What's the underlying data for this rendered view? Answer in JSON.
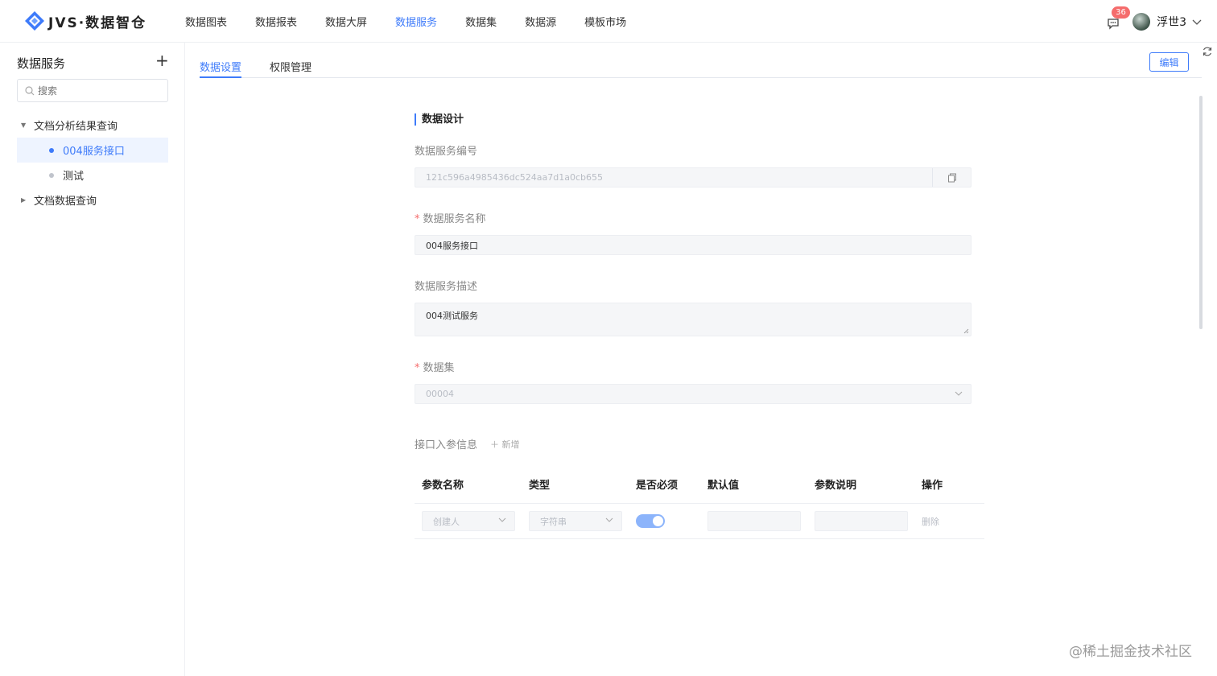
{
  "app": {
    "brand": "JVS·数据智仓",
    "accent": "#3e7bfa"
  },
  "nav": {
    "items": [
      {
        "label": "数据图表",
        "active": false
      },
      {
        "label": "数据报表",
        "active": false
      },
      {
        "label": "数据大屏",
        "active": false
      },
      {
        "label": "数据服务",
        "active": true
      },
      {
        "label": "数据集",
        "active": false
      },
      {
        "label": "数据源",
        "active": false
      },
      {
        "label": "模板市场",
        "active": false
      }
    ]
  },
  "header": {
    "message_icon": "message-icon",
    "badge_count": "36",
    "username": "浮世3",
    "dropdown_icon": "chevron-down-icon"
  },
  "sidebar": {
    "title": "数据服务",
    "add_icon": "plus-icon",
    "search_placeholder": "搜索",
    "tree": [
      {
        "label": "文档分析结果查询",
        "expanded": true,
        "children": [
          {
            "label": "004服务接口",
            "selected": true
          },
          {
            "label": "测试",
            "selected": false
          }
        ]
      },
      {
        "label": "文档数据查询",
        "expanded": false,
        "children": []
      }
    ]
  },
  "main": {
    "tabs": [
      {
        "label": "数据设置",
        "active": true
      },
      {
        "label": "权限管理",
        "active": false
      }
    ],
    "edit_label": "编辑",
    "refresh_icon": "refresh-icon"
  },
  "form": {
    "section_title": "数据设计",
    "service_id_label": "数据服务编号",
    "service_id_value": "121c596a4985436dc524aa7d1a0cb655",
    "service_name_label": "数据服务名称",
    "service_name_required": "*",
    "service_name_value": "004服务接口",
    "desc_label": "数据服务描述",
    "desc_value": "004测试服务",
    "dataset_label": "数据集",
    "dataset_required": "*",
    "dataset_value": "00004",
    "params_title": "接口入参信息",
    "add_label": "新增"
  },
  "params_table": {
    "headers": [
      "参数名称",
      "类型",
      "是否必须",
      "默认值",
      "参数说明",
      "操作"
    ],
    "rows": [
      {
        "name": "创建人",
        "type": "字符串",
        "required": true,
        "default": "",
        "desc": "",
        "action": "删除"
      }
    ]
  },
  "watermark": "@稀土掘金技术社区"
}
